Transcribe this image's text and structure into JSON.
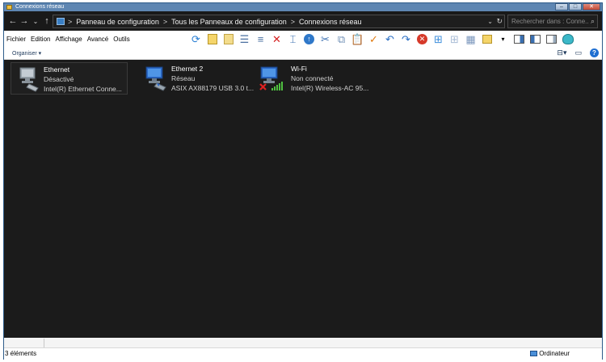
{
  "window": {
    "title": "Connexions réseau"
  },
  "address": {
    "crumbs": [
      "Panneau de configuration",
      "Tous les Panneaux de configuration",
      "Connexions réseau"
    ],
    "separator": ">"
  },
  "search": {
    "placeholder": "Rechercher dans : Conne..."
  },
  "menu": {
    "items": [
      "Fichier",
      "Edition",
      "Affichage",
      "Avancé",
      "Outils"
    ]
  },
  "organiser": {
    "label": "Organiser ▾"
  },
  "connections": [
    {
      "name": "Ethernet",
      "status": "Désactivé",
      "device": "Intel(R) Ethernet Conne...",
      "state": "disabled"
    },
    {
      "name": "Ethernet 2",
      "status": "Réseau",
      "device": "ASIX AX88179 USB 3.0 t...",
      "state": "connected"
    },
    {
      "name": "Wi-Fi",
      "status": "Non connecté",
      "device": "Intel(R) Wireless-AC 95...",
      "state": "not-connected"
    }
  ],
  "statusbar": {
    "count": "3 éléments",
    "location": "Ordinateur"
  },
  "colors": {
    "background": "#1b1b1b",
    "titlebar": "#5e86b2",
    "accent": "#1f6fd1"
  }
}
